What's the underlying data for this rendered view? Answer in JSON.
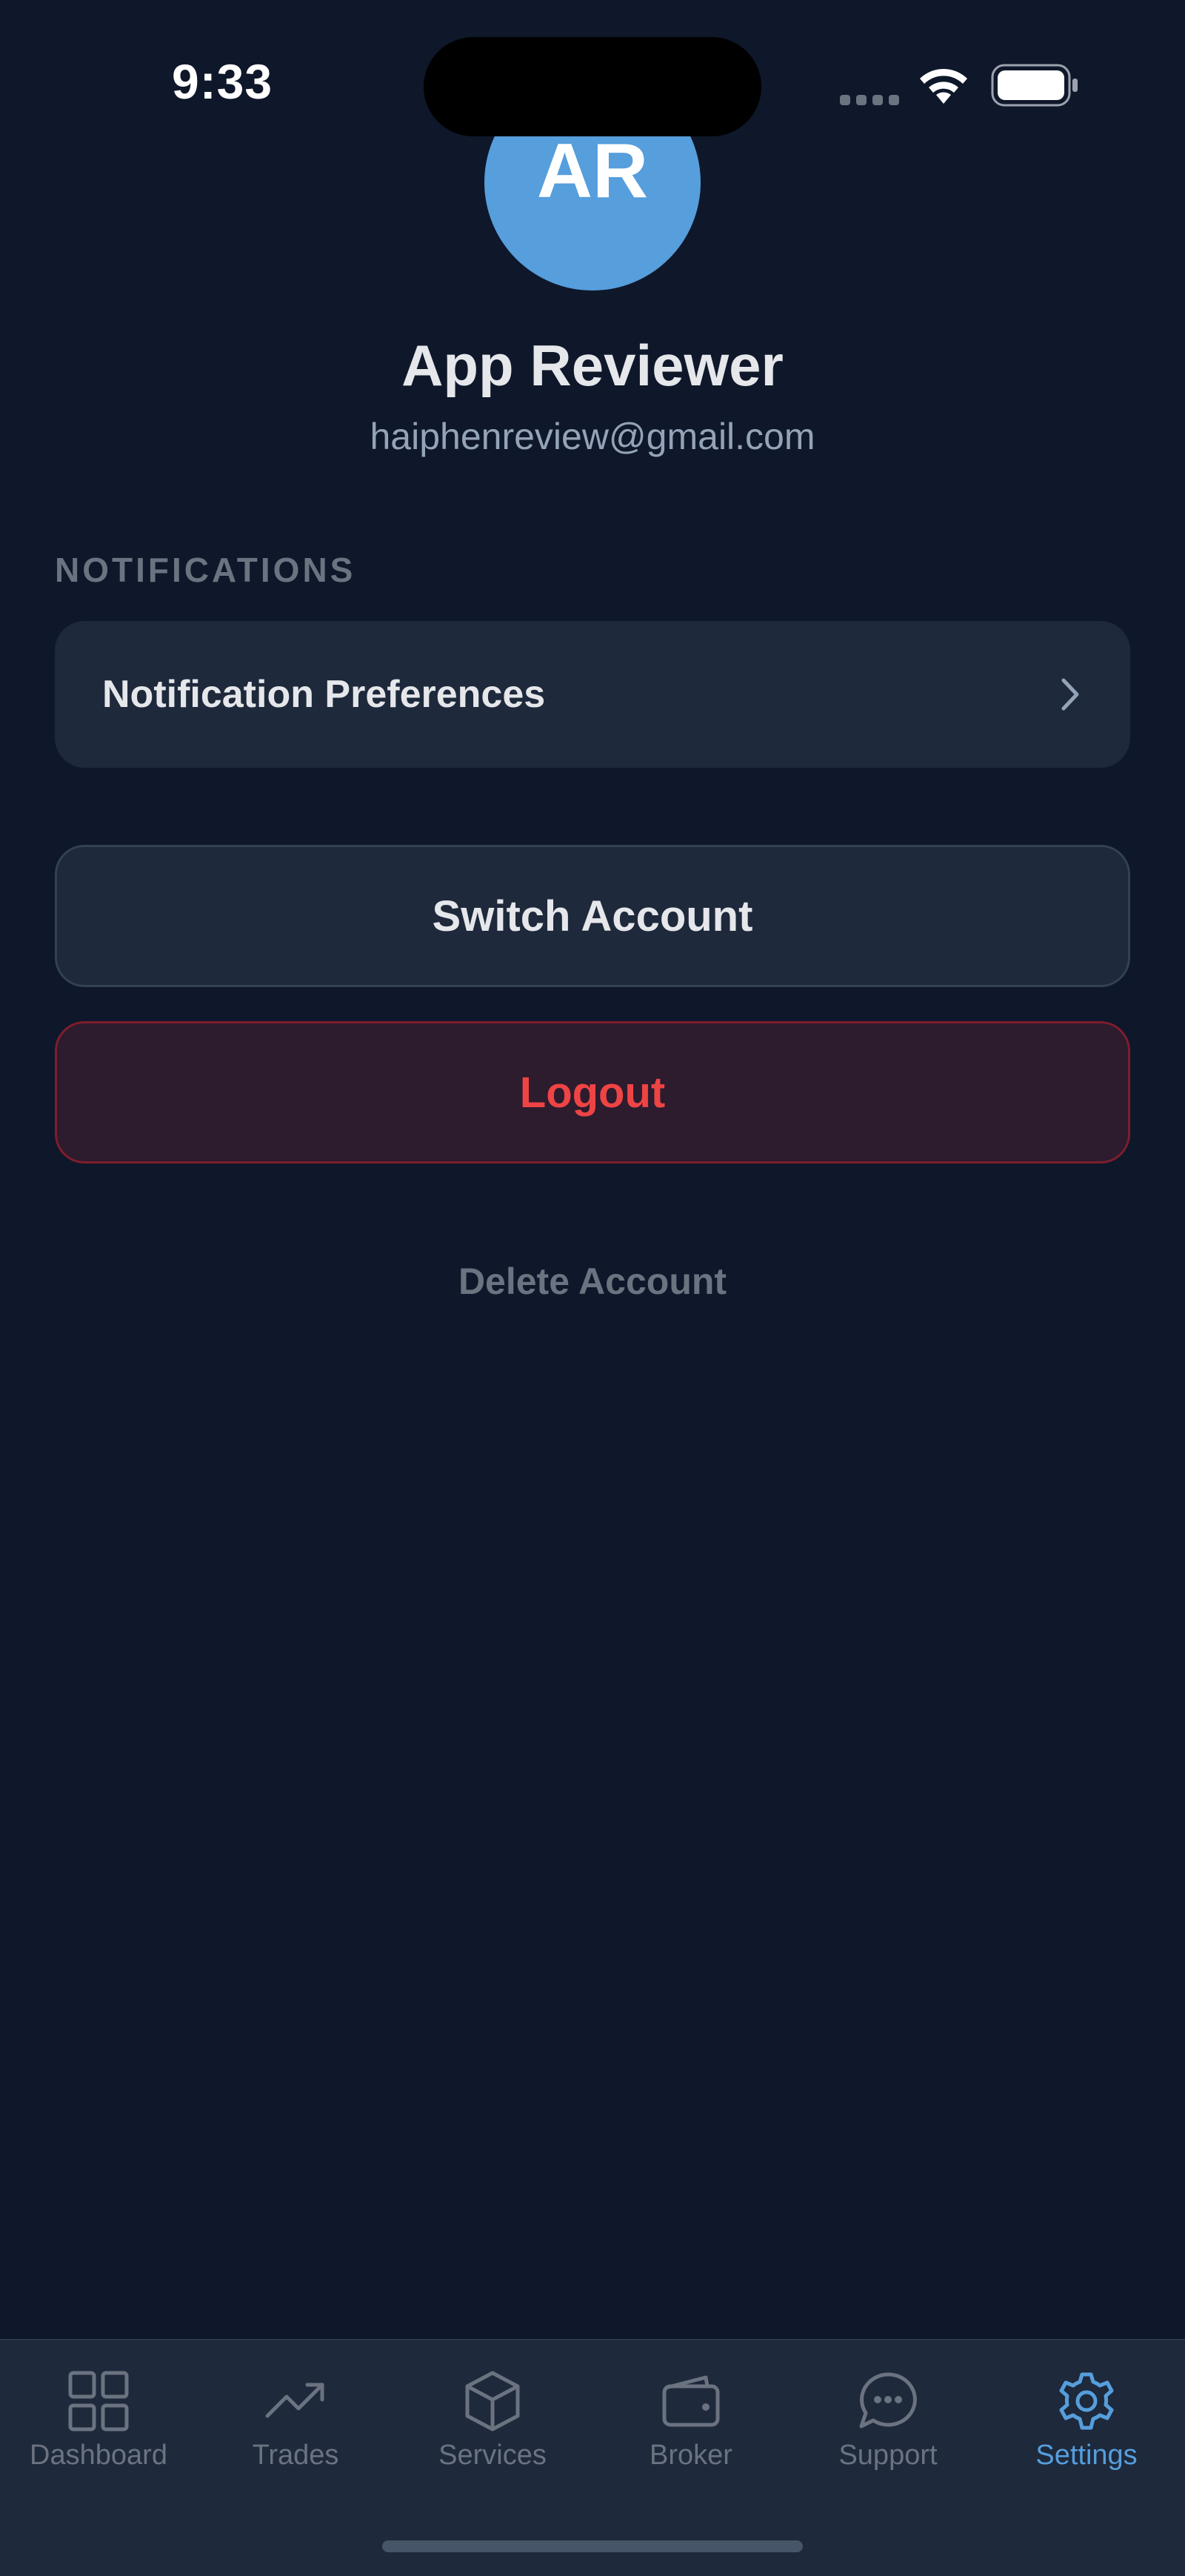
{
  "status_bar": {
    "time": "9:33"
  },
  "profile": {
    "initials": "AR",
    "name": "App Reviewer",
    "email": "haiphenreview@gmail.com",
    "avatar_color": "#569edc"
  },
  "notifications_section": {
    "heading": "NOTIFICATIONS",
    "preferences_label": "Notification Preferences"
  },
  "actions": {
    "switch_account": "Switch Account",
    "logout": "Logout",
    "delete_account": "Delete Account"
  },
  "tab_bar": {
    "active_tab": "Settings",
    "tabs": [
      {
        "label": "Dashboard",
        "icon": "grid-icon"
      },
      {
        "label": "Trades",
        "icon": "trending-up-icon"
      },
      {
        "label": "Services",
        "icon": "box-icon"
      },
      {
        "label": "Broker",
        "icon": "wallet-icon"
      },
      {
        "label": "Support",
        "icon": "chat-bubble-icon"
      },
      {
        "label": "Settings",
        "icon": "gear-icon"
      }
    ]
  },
  "colors": {
    "background": "#0f172a",
    "card": "#1e293b",
    "accent": "#569edc",
    "danger": "#ef4444",
    "muted": "#6b7280"
  }
}
